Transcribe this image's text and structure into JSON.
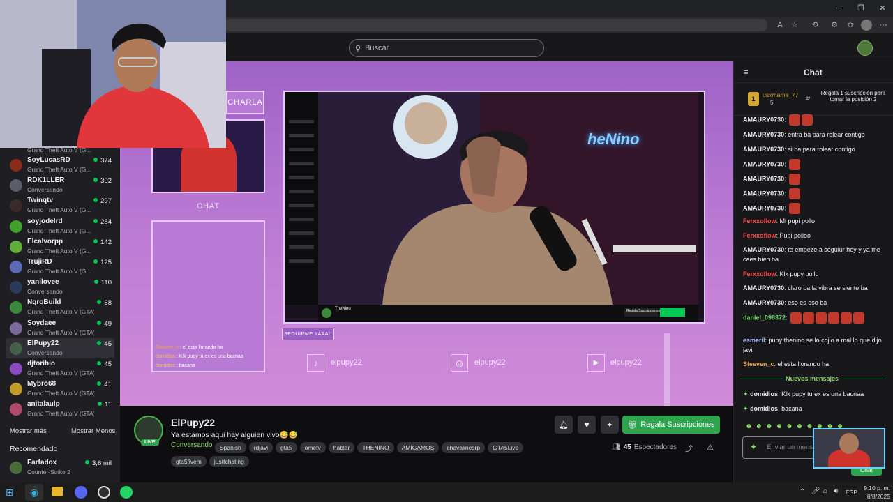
{
  "browser": {
    "icons": [
      "read-aloud-icon",
      "star-icon",
      "extensions-icon",
      "performance-icon",
      "favorites-icon",
      "profile-icon",
      "more-icon"
    ]
  },
  "topnav": {
    "search_placeholder": "Buscar"
  },
  "sidebar": {
    "partial_game_top": "Grand Theft Auto V (G...",
    "channels": [
      {
        "name": "SoyLucasRD",
        "game": "Grand Theft Auto V (G...",
        "viewers": "374",
        "color": "#8a2c1a"
      },
      {
        "name": "RDK1LLER",
        "game": "Conversando",
        "viewers": "302",
        "color": "#5b5b6a"
      },
      {
        "name": "Twinqtv",
        "game": "Grand Theft Auto V (G...",
        "viewers": "297",
        "color": "#3a2a2a"
      },
      {
        "name": "soyjodelrd",
        "game": "Grand Theft Auto V (G...",
        "viewers": "284",
        "color": "#3fa02a"
      },
      {
        "name": "Elcalvorpp",
        "game": "Grand Theft Auto V (G...",
        "viewers": "142",
        "color": "#5fae3a"
      },
      {
        "name": "TrujiRD",
        "game": "Grand Theft Auto V (G...",
        "viewers": "125",
        "color": "#5a6ab5"
      },
      {
        "name": "yanilovee",
        "game": "Conversando",
        "viewers": "110",
        "color": "#2a3a5a"
      },
      {
        "name": "NgroBuild",
        "game": "Grand Theft Auto V (GTA)",
        "viewers": "58",
        "color": "#3a8a3a"
      },
      {
        "name": "Soydaee",
        "game": "Grand Theft Auto V (GTA)",
        "viewers": "49",
        "color": "#7a6a9a"
      },
      {
        "name": "ElPupy22",
        "game": "Conversando",
        "viewers": "45",
        "color": "#44604a"
      },
      {
        "name": "djtoribio",
        "game": "Grand Theft Auto V (GTA)",
        "viewers": "45",
        "color": "#8a4ac0"
      },
      {
        "name": "Mybro68",
        "game": "Grand Theft Auto V (GTA)",
        "viewers": "41",
        "color": "#c09a2a"
      },
      {
        "name": "anitalaulp",
        "game": "Grand Theft Auto V (GTA)",
        "viewers": "11",
        "color": "#b04a6a"
      }
    ],
    "show_more": "Mostrar más",
    "show_less": "Mostrar Menos",
    "recommended_header": "Recomendado",
    "recommended": [
      {
        "name": "Farfadox",
        "game": "Counter-Strike 2",
        "viewers": "3,6 mil",
        "color": "#4a6a3a"
      }
    ]
  },
  "overlay": {
    "charla": "CHARLA",
    "chat": "CHAT",
    "follow_banner": "SEGUIRME YAAA!!",
    "mini_chat": [
      {
        "user": "Steeven_c",
        "text": " : el esta llorando ha",
        "color": "#e8a84a"
      },
      {
        "user": "domidios",
        "text": " : Klk pupy tu ex es una bacnaa",
        "color": "#f0c060"
      },
      {
        "user": "domidios",
        "text": " : bacana",
        "color": "#f0c060"
      }
    ],
    "socials": [
      {
        "icon": "tiktok-icon",
        "handle": "elpupy22"
      },
      {
        "icon": "instagram-icon",
        "handle": "elpupy22"
      },
      {
        "icon": "youtube-icon",
        "handle": "elpupy22"
      }
    ],
    "embedded": {
      "name": "TheNino",
      "gift_label": "Regala Suscripciones",
      "neon_sign": "heNino"
    }
  },
  "stream_info": {
    "channel": "ElPupy22",
    "live_badge": "LIVE",
    "title": "Ya estamos aqui hay alguien vivo😅😅",
    "category": "Conversando",
    "tags": [
      "Spanish",
      "rdjavi",
      "gta5",
      "ometv",
      "hablar",
      "THENINO",
      "AMIGAMOS",
      "chavalinesrp",
      "GTA5Live",
      "gta5fivem",
      "justtchating"
    ],
    "gift_button": "Regala Suscripciones",
    "viewers": "45",
    "viewers_label": "Espectadores"
  },
  "chat": {
    "title": "Chat",
    "leader": {
      "rank": "1",
      "user": "usxrname_77",
      "count": "5"
    },
    "gift_prompt": "Regala 1 suscripción para tomar la posición 2",
    "messages": [
      {
        "user": "AMAURY0730",
        "text": "",
        "color": "#efeff1",
        "emotes": 2
      },
      {
        "user": "AMAURY0730",
        "text": "entra ba para rolear contigo",
        "color": "#efeff1",
        "emotes": 0
      },
      {
        "user": "AMAURY0730",
        "text": "si ba para rolear contigo",
        "color": "#efeff1",
        "emotes": 0
      },
      {
        "user": "AMAURY0730",
        "text": "",
        "color": "#efeff1",
        "emotes": 1
      },
      {
        "user": "AMAURY0730",
        "text": "",
        "color": "#efeff1",
        "emotes": 1
      },
      {
        "user": "AMAURY0730",
        "text": "",
        "color": "#efeff1",
        "emotes": 1
      },
      {
        "user": "AMAURY0730",
        "text": "",
        "color": "#efeff1",
        "emotes": 1
      },
      {
        "user": "Ferxxoflow",
        "text": "Mi pupi pollo",
        "color": "#ff4a4a",
        "emotes": 0
      },
      {
        "user": "Ferxxoflow",
        "text": "Pupi polloo",
        "color": "#ff4a4a",
        "emotes": 0
      },
      {
        "user": "AMAURY0730",
        "text": "te empeze a seguiur hoy y ya me caes bien ba",
        "color": "#efeff1",
        "emotes": 0
      },
      {
        "user": "Ferxxoflow",
        "text": "Klk pupy pollo",
        "color": "#ff4a4a",
        "emotes": 0
      },
      {
        "user": "AMAURY0730",
        "text": "claro ba la vibra se siente ba",
        "color": "#efeff1",
        "emotes": 0
      },
      {
        "user": "AMAURY0730",
        "text": "eso es eso ba",
        "color": "#efeff1",
        "emotes": 0
      },
      {
        "user": "daniel_098372",
        "text": "",
        "color": "#6fd66f",
        "emotes": 6
      },
      {
        "user": "esmeril",
        "text": "pupy thenino se lo cojio a mal lo que dijo javi",
        "color": "#a8b8ff",
        "emotes": 0
      },
      {
        "user": "Steeven_c",
        "text": "el esta llorando ha",
        "color": "#e8a84a",
        "emotes": 0
      }
    ],
    "new_messages_label": "Nuevos mensajes",
    "new_messages": [
      {
        "user": "domidios",
        "text": "Klk pupy tu ex es una bacnaa",
        "color": "#efeff1"
      },
      {
        "user": "domidios",
        "text": "bacana",
        "color": "#efeff1"
      }
    ],
    "input_placeholder": "Enviar un mensaje",
    "send_label": "Chat"
  },
  "taskbar": {
    "apps": [
      "windows-start-icon",
      "edge-icon",
      "file-explorer-icon",
      "discord-icon",
      "obs-icon",
      "whatsapp-icon"
    ],
    "lang": "ESP",
    "time": "9:10 p. m.",
    "date": "8/8/2025"
  }
}
